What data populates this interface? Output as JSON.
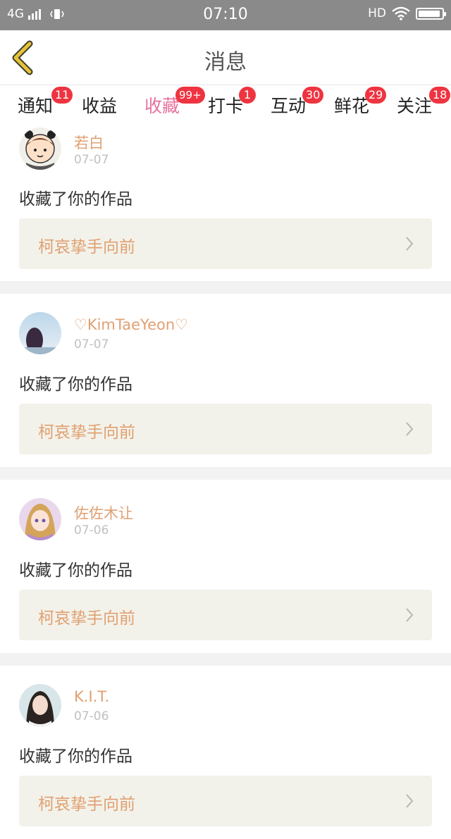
{
  "status_bar": {
    "network": "4G",
    "time": "07:10",
    "hd_label": "HD",
    "battery_level": 0.95
  },
  "header": {
    "title": "消息"
  },
  "tabs": [
    {
      "label": "通知",
      "badge": "11",
      "active": false
    },
    {
      "label": "收益",
      "badge": "",
      "active": false
    },
    {
      "label": "收藏",
      "badge": "99+",
      "active": true
    },
    {
      "label": "打卡",
      "badge": "1",
      "active": false
    },
    {
      "label": "互动",
      "badge": "30",
      "active": false
    },
    {
      "label": "鲜花",
      "badge": "29",
      "active": false
    },
    {
      "label": "关注",
      "badge": "18",
      "active": false
    }
  ],
  "messages": [
    {
      "user": "若白",
      "date": "07-07",
      "action": "收藏了你的作品",
      "work_title": "柯哀挚手向前",
      "avatar": "cartoon-avatar"
    },
    {
      "user": "♡KimTaeYeon♡",
      "date": "07-07",
      "action": "收藏了你的作品",
      "work_title": "柯哀挚手向前",
      "avatar": "photo-avatar"
    },
    {
      "user": "佐佐木让",
      "date": "07-06",
      "action": "收藏了你的作品",
      "work_title": "柯哀挚手向前",
      "avatar": "anime-avatar"
    },
    {
      "user": "K.I.T.",
      "date": "07-06",
      "action": "收藏了你的作品",
      "work_title": "柯哀挚手向前",
      "avatar": "portrait-avatar"
    }
  ],
  "colors": {
    "accent": "#e8719f",
    "username": "#e0a072",
    "badge": "#ee3440",
    "back_arrow": "#e6c13a",
    "status_bar": "#8a8a8a"
  }
}
